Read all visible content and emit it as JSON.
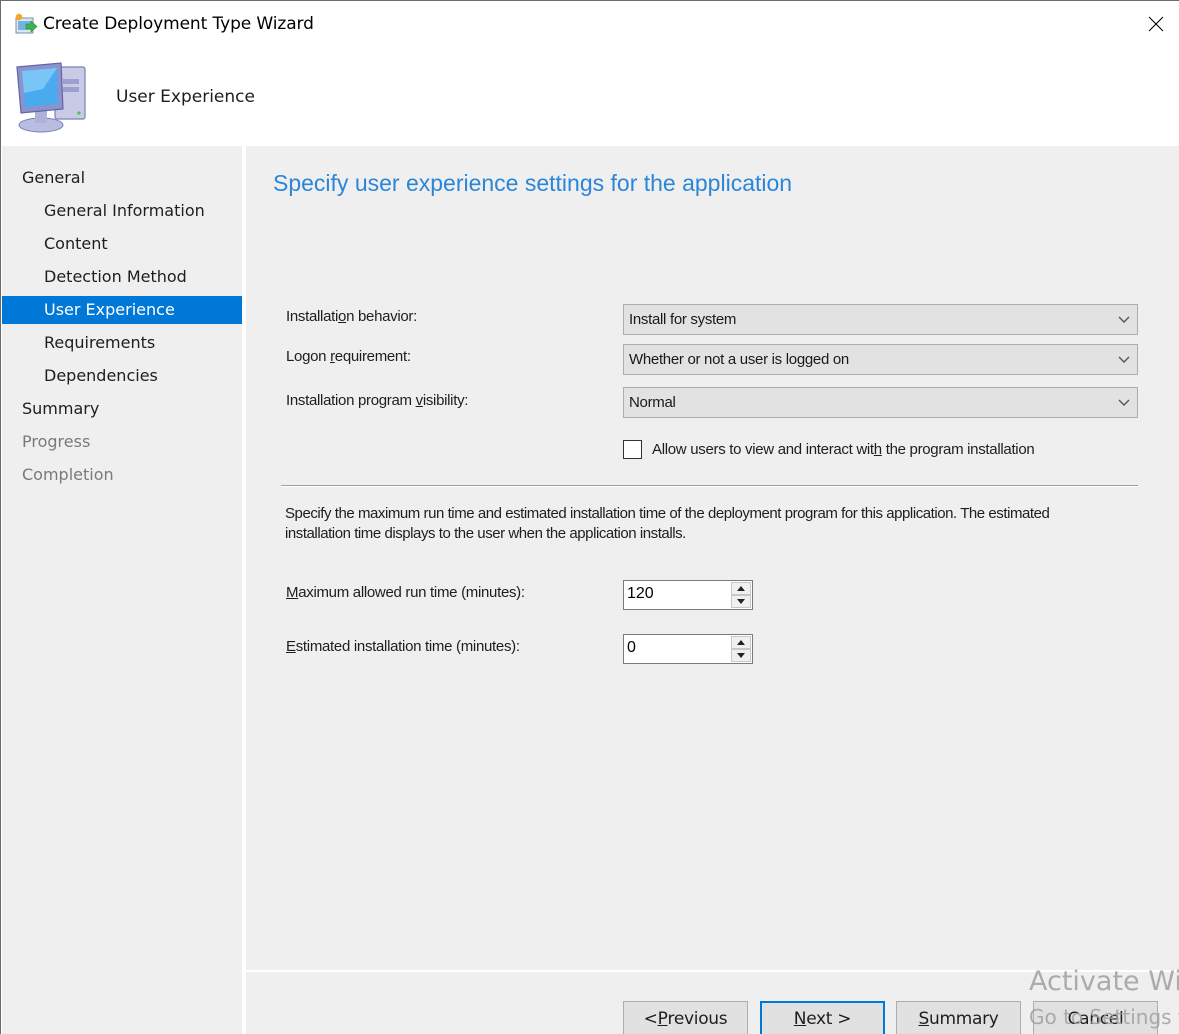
{
  "window": {
    "title": "Create Deployment Type Wizard",
    "close_label": "Close"
  },
  "banner": {
    "title": "User Experience"
  },
  "nav": {
    "items": [
      {
        "label": "General",
        "level": 1,
        "state": "normal"
      },
      {
        "label": "General Information",
        "level": 2,
        "state": "normal"
      },
      {
        "label": "Content",
        "level": 2,
        "state": "normal"
      },
      {
        "label": "Detection Method",
        "level": 2,
        "state": "normal"
      },
      {
        "label": "User Experience",
        "level": 2,
        "state": "active"
      },
      {
        "label": "Requirements",
        "level": 2,
        "state": "normal"
      },
      {
        "label": "Dependencies",
        "level": 2,
        "state": "normal"
      },
      {
        "label": "Summary",
        "level": 1,
        "state": "normal"
      },
      {
        "label": "Progress",
        "level": 1,
        "state": "disabled"
      },
      {
        "label": "Completion",
        "level": 1,
        "state": "disabled"
      }
    ]
  },
  "main": {
    "heading": "Specify user experience settings for the application",
    "installation_behavior": {
      "label_pre": "Installati",
      "label_u": "o",
      "label_post": "n behavior:",
      "value": "Install for system"
    },
    "logon_requirement": {
      "label_pre": "Logon ",
      "label_u": "r",
      "label_post": "equirement:",
      "value": "Whether or not a user is logged on"
    },
    "program_visibility": {
      "label_pre": "Installation program ",
      "label_u": "v",
      "label_post": "isibility:",
      "value": "Normal"
    },
    "allow_interact": {
      "label_pre": "Allow users to view and interact wit",
      "label_u": "h",
      "label_post": " the program installation",
      "checked": false
    },
    "description": "Specify the maximum run time and estimated installation time of the deployment program for this application. The estimated installation time displays to the user when the application installs.",
    "max_run_time": {
      "label_u": "M",
      "label_post": "aximum allowed run time (minutes):",
      "value": "120"
    },
    "estimated_time": {
      "label_u": "E",
      "label_post": "stimated installation time (minutes):",
      "value": "0"
    }
  },
  "footer": {
    "previous": {
      "pre": "< ",
      "u": "P",
      "post": "revious"
    },
    "next": {
      "pre": "",
      "u": "N",
      "post": "ext >"
    },
    "summary": {
      "pre": "",
      "u": "S",
      "post": "ummary"
    },
    "cancel": {
      "pre": "",
      "u": "",
      "post": "Cancel"
    }
  },
  "watermark": {
    "line1": "Activate Windows",
    "line2": "Go to Settings to activate Windows."
  },
  "colors": {
    "accent": "#0078d7",
    "heading": "#2b86d8",
    "panel_bg": "#efefef"
  }
}
